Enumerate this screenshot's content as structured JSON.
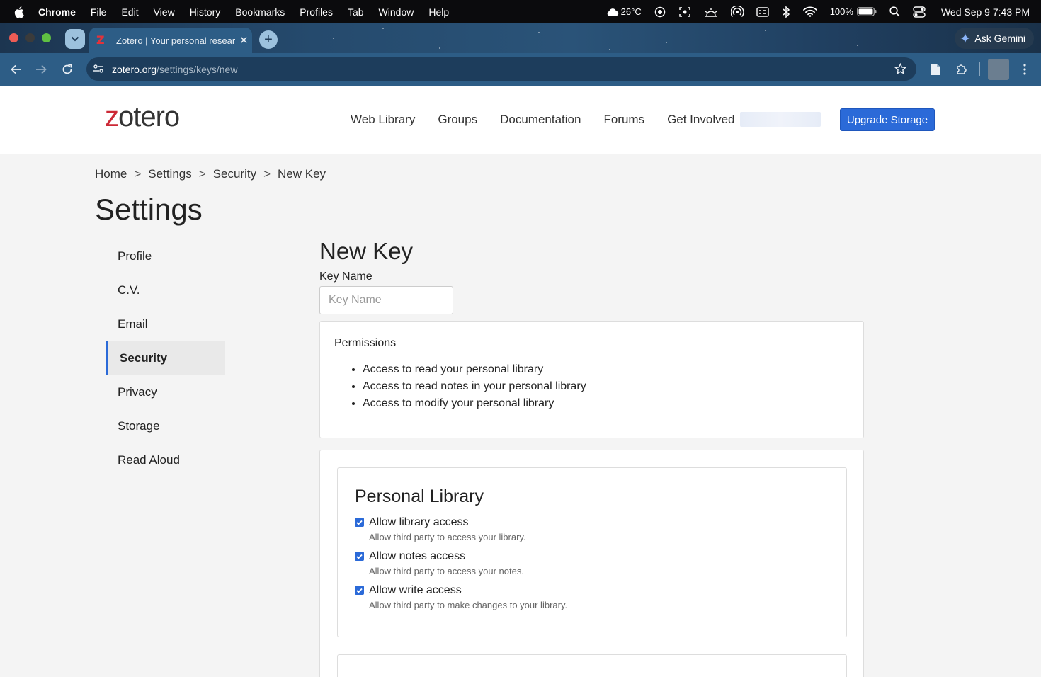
{
  "menubar": {
    "app": "Chrome",
    "items": [
      "File",
      "Edit",
      "View",
      "History",
      "Bookmarks",
      "Profiles",
      "Tab",
      "Window",
      "Help"
    ],
    "weather": "26°C",
    "battery": "100%",
    "datetime": "Wed Sep 9  7:43 PM"
  },
  "browser": {
    "tab_title": "Zotero | Your personal research",
    "tab_favicon": "Z",
    "gemini_label": "Ask Gemini",
    "url_host": "zotero.org",
    "url_path": "/settings/keys/new"
  },
  "site": {
    "logo_z": "z",
    "logo_rest": "otero",
    "nav": [
      "Web Library",
      "Groups",
      "Documentation",
      "Forums",
      "Get Involved"
    ],
    "upgrade_label": "Upgrade Storage"
  },
  "breadcrumb": [
    "Home",
    "Settings",
    "Security",
    "New Key"
  ],
  "breadcrumb_sep": ">",
  "page_title": "Settings",
  "sidenav": [
    {
      "label": "Profile",
      "active": false
    },
    {
      "label": "C.V.",
      "active": false
    },
    {
      "label": "Email",
      "active": false
    },
    {
      "label": "Security",
      "active": true
    },
    {
      "label": "Privacy",
      "active": false
    },
    {
      "label": "Storage",
      "active": false
    },
    {
      "label": "Read Aloud",
      "active": false
    }
  ],
  "form": {
    "heading": "New Key",
    "key_name_label": "Key Name",
    "key_name_placeholder": "Key Name",
    "key_name_value": ""
  },
  "permissions": {
    "title": "Permissions",
    "items": [
      "Access to read your personal library",
      "Access to read notes in your personal library",
      "Access to modify your personal library"
    ]
  },
  "personal_library": {
    "heading": "Personal Library",
    "options": [
      {
        "label": "Allow library access",
        "help": "Allow third party to access your library.",
        "checked": true
      },
      {
        "label": "Allow notes access",
        "help": "Allow third party to access your notes.",
        "checked": true
      },
      {
        "label": "Allow write access",
        "help": "Allow third party to make changes to your library.",
        "checked": true
      }
    ]
  },
  "colors": {
    "accent": "#2b6ad8",
    "logo_red": "#cc2936",
    "browser_frame": "#2d5d86"
  }
}
